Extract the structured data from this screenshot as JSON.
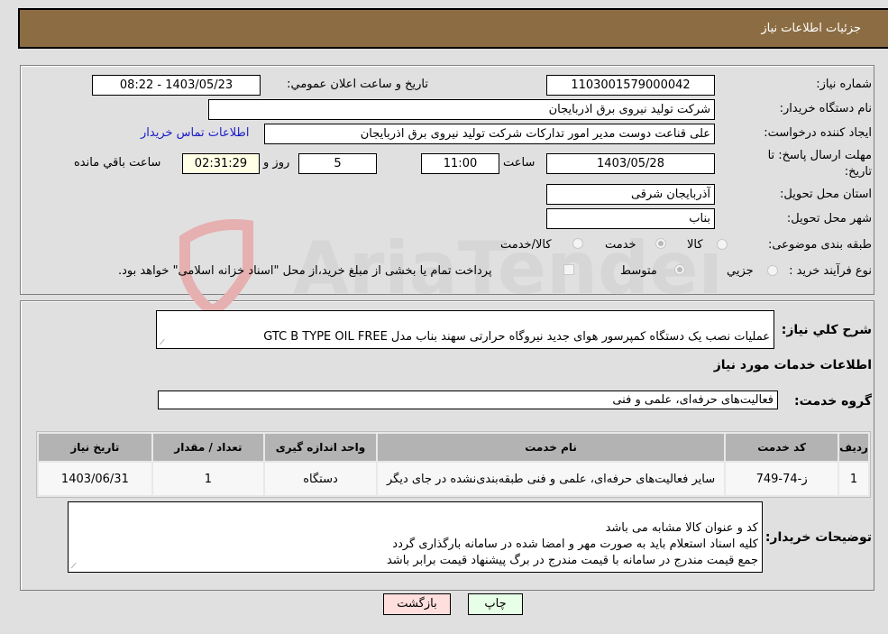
{
  "header": {
    "title": "جزئیات اطلاعات نیاز"
  },
  "details": {
    "need_number": {
      "label": "شماره نیاز:",
      "value": "1103001579000042"
    },
    "announce_datetime": {
      "label": "تاریخ و ساعت اعلان عمومي:",
      "value": "1403/05/23 - 08:22"
    },
    "buyer_org": {
      "label": "نام دستگاه خریدار:",
      "value": "شرکت تولید نیروی برق اذربایجان"
    },
    "requester": {
      "label": "ایجاد کننده درخواست:",
      "value": "علی قناعت دوست مدیر امور تدارکات شرکت تولید نیروی برق اذربایجان"
    },
    "buyer_contact_link": "اطلاعات تماس خریدار",
    "deadline": {
      "label": "مهلت ارسال پاسخ: تا تاریخ:",
      "date": "1403/05/28",
      "time_label": "ساعت",
      "time": "11:00",
      "days": "5",
      "days_label": "روز و",
      "remaining": "02:31:29",
      "remaining_label": "ساعت باقي مانده"
    },
    "province": {
      "label": "استان محل تحویل:",
      "value": "آذربایجان شرقی"
    },
    "city": {
      "label": "شهر محل تحویل:",
      "value": "بناب"
    },
    "category": {
      "label": "طبقه بندی موضوعی:",
      "options": [
        "کالا",
        "خدمت",
        "کالا/خدمت"
      ],
      "selected": "خدمت"
    },
    "purchase_type": {
      "label": "نوع فرآیند خرید :",
      "options": [
        "جزيي",
        "متوسط"
      ],
      "selected": "متوسط",
      "treasury_note": "پرداخت تمام یا بخشی از مبلغ خرید،از محل \"اسناد خزانه اسلامی\" خواهد بود."
    }
  },
  "description": {
    "label": "شرح كلي نياز:",
    "value": "عملیات نصب یک دستگاه کمپرسور هوای جدید نیروگاه حرارتی سهند بناب مدل GTC B TYPE OIL FREE"
  },
  "services_section": {
    "title": "اطلاعات خدمات مورد نیاز",
    "group_label": "گروه خدمت:",
    "group_value": "فعالیت‌های حرفه‌ای، علمی و فنی",
    "table": {
      "headers": [
        "ردیف",
        "کد خدمت",
        "نام خدمت",
        "واحد اندازه گیری",
        "تعداد / مقدار",
        "تاریخ نیاز"
      ],
      "rows": [
        [
          "1",
          "ز-74-749",
          "سایر فعالیت‌های حرفه‌ای، علمی و فنی طبقه‌بندی‌نشده در جای دیگر",
          "دستگاه",
          "1",
          "1403/06/31"
        ]
      ]
    }
  },
  "buyer_notes": {
    "label": "توضیحات خریدار:",
    "value": "کد و عنوان کالا مشابه می باشد\nکلیه اسناد استعلام باید به صورت مهر و امضا شده در سامانه بارگذاری گردد\nجمع قیمت مندرج در سامانه با قیمت مندرج در برگ پیشنهاد قیمت برابر باشد"
  },
  "buttons": {
    "print": "چاپ",
    "back": "بازگشت"
  },
  "watermark": "AriaTender.neT"
}
